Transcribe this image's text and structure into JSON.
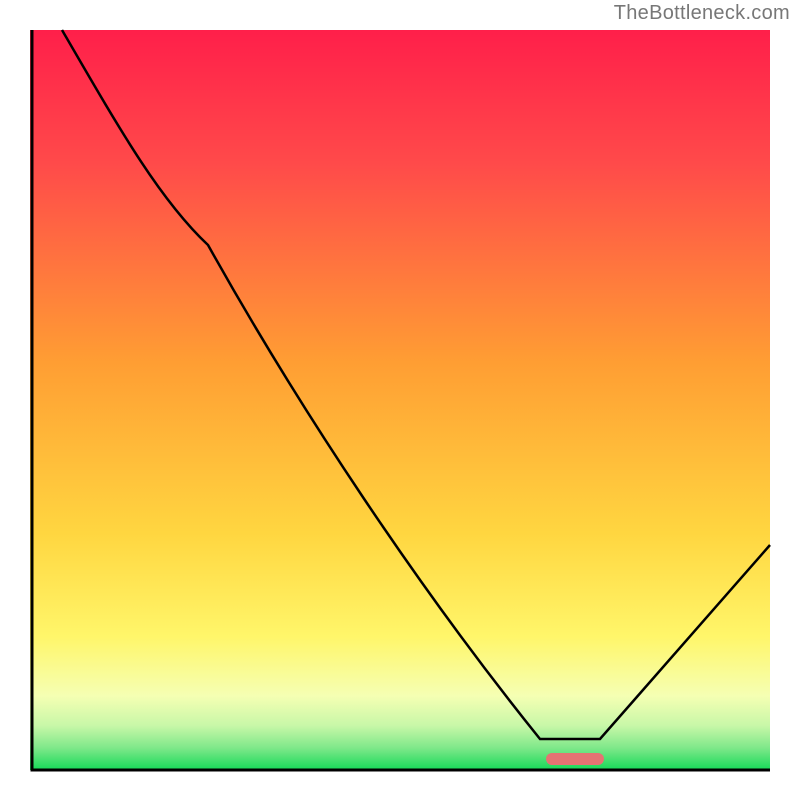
{
  "watermark": "TheBottleneck.com",
  "colors": {
    "gradient_top": "#ff1f4a",
    "gradient_mid_orange": "#ff9e33",
    "gradient_mid_yellow": "#fff66a",
    "gradient_bottom": "#16d958",
    "curve": "#000000",
    "marker": "#e57373",
    "axis": "#000000",
    "watermark_text": "#777777"
  },
  "chart_data": {
    "type": "line",
    "title": "",
    "xlabel": "",
    "ylabel": "",
    "xlim": [
      0,
      100
    ],
    "ylim": [
      0,
      100
    ],
    "grid": false,
    "legend": false,
    "x": [
      4,
      11,
      18,
      24,
      31,
      38,
      44,
      51,
      58,
      65,
      69,
      73,
      77,
      82,
      88,
      94,
      100
    ],
    "values": [
      100,
      88,
      78,
      71,
      61,
      51,
      42,
      32,
      22,
      12,
      4,
      0,
      0,
      5,
      13,
      22,
      30
    ],
    "series": [
      {
        "name": "curve",
        "x": [
          4,
          11,
          18,
          24,
          31,
          38,
          44,
          51,
          58,
          65,
          69,
          73,
          77,
          82,
          88,
          94,
          100
        ],
        "values": [
          100,
          88,
          78,
          71,
          61,
          51,
          42,
          32,
          22,
          12,
          4,
          0,
          0,
          5,
          13,
          22,
          30
        ]
      }
    ],
    "marker": {
      "x_range": [
        70,
        78
      ],
      "y": 0,
      "color": "#e57373"
    },
    "background": "vertical-gradient red→orange→yellow→green"
  }
}
